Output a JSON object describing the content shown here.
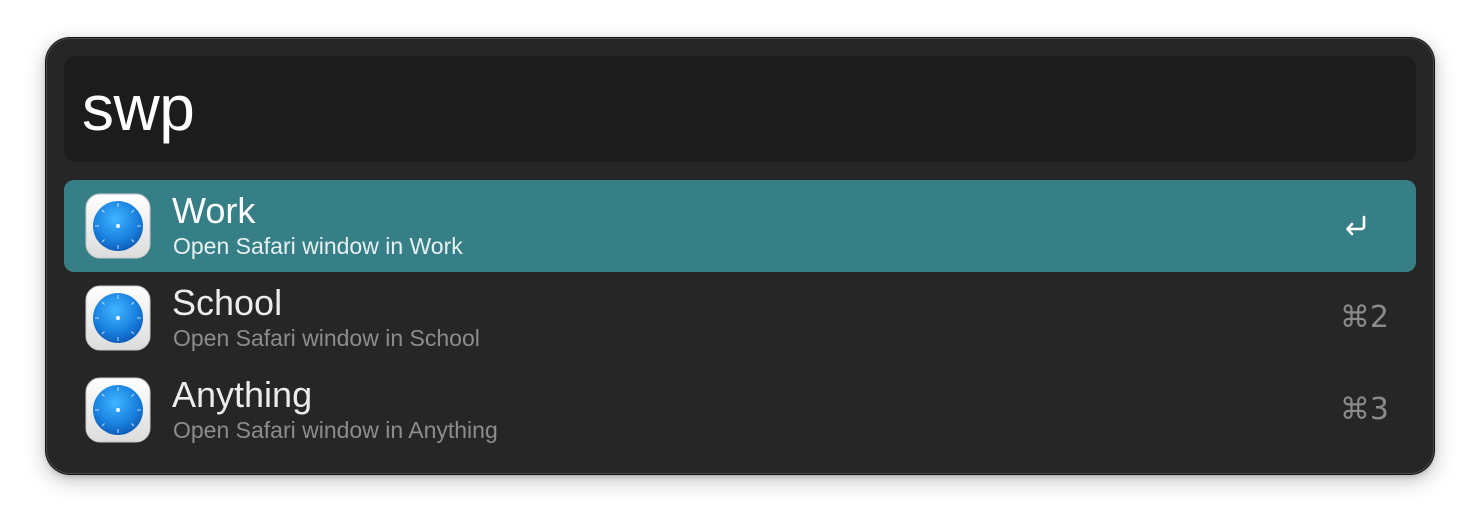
{
  "search": {
    "query": "swp"
  },
  "results": [
    {
      "title": "Work",
      "subtitle": "Open Safari window in Work",
      "icon": "safari-icon",
      "action": "return-icon",
      "selected": true
    },
    {
      "title": "School",
      "subtitle": "Open Safari window in School",
      "icon": "safari-icon",
      "shortcut": "⌘2",
      "selected": false
    },
    {
      "title": "Anything",
      "subtitle": "Open Safari window in Anything",
      "icon": "safari-icon",
      "shortcut": "⌘3",
      "selected": false
    }
  ],
  "colors": {
    "window_bg": "#262626",
    "search_bg": "#1c1c1c",
    "selection": "#377f86"
  }
}
